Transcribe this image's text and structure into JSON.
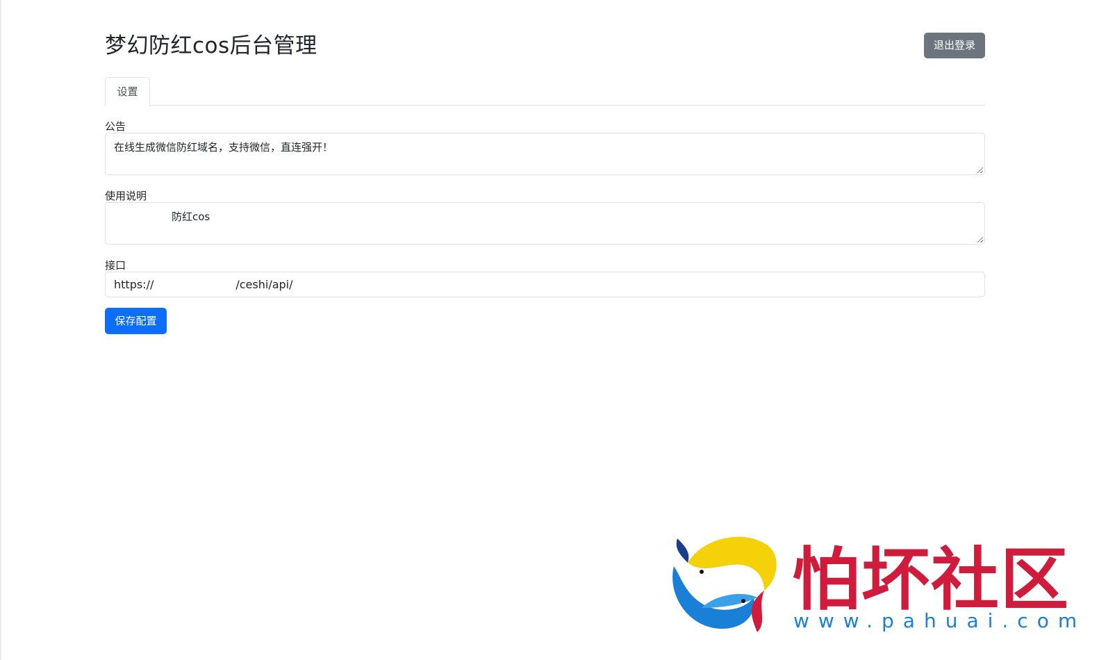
{
  "header": {
    "title": "梦幻防红cos后台管理",
    "logout_label": "退出登录"
  },
  "tabs": [
    {
      "label": "设置",
      "active": true
    }
  ],
  "form": {
    "notice": {
      "label": "公告",
      "value": "在线生成微信防红域名，支持微信，直连强开！"
    },
    "instructions": {
      "label": "使用说明",
      "value": "防红cos"
    },
    "api": {
      "label": "接口",
      "value_prefix": "https://",
      "value_suffix": "/ceshi/api/"
    },
    "save_label": "保存配置"
  },
  "watermark": {
    "text": "怕坏社区",
    "url": "www.pahuai.com"
  },
  "colors": {
    "primary": "#0d6efd",
    "secondary": "#6c757d",
    "border": "#dee2e6",
    "watermark_red": "#d01c3c",
    "watermark_blue": "#1a7fd6"
  }
}
